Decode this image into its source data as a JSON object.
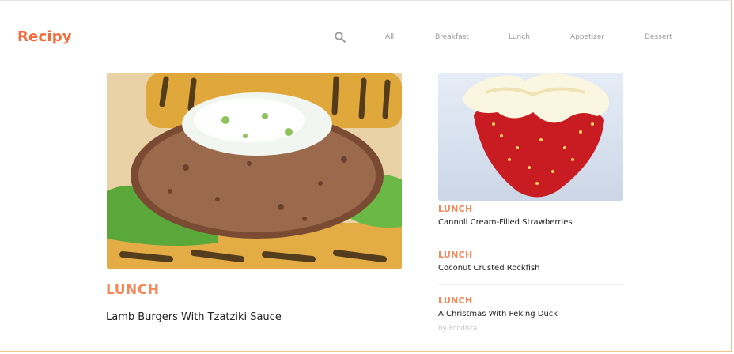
{
  "brand": {
    "name": "Recipy",
    "color": "#f26b3a"
  },
  "nav": {
    "search_icon": "search-icon",
    "items": [
      "All",
      "Breakfast",
      "Lunch",
      "Appetizer",
      "Dessert"
    ]
  },
  "featured": {
    "category": "LUNCH",
    "title": "Lamb Burgers With Tzatziki Sauce",
    "image": "lamb-burger-photo"
  },
  "sidebar": {
    "image": "cannoli-strawberry-photo",
    "items": [
      {
        "category": "LUNCH",
        "title": "Cannoli Cream-Filled Strawberries"
      },
      {
        "category": "LUNCH",
        "title": "Coconut Crusted Rockfish"
      },
      {
        "category": "LUNCH",
        "title": "A Christmas With Peking Duck",
        "byline": "By Foodista"
      }
    ]
  },
  "colors": {
    "accent": "#f5885a",
    "border": "#f6c089",
    "nav_text": "#9a9a9a"
  }
}
